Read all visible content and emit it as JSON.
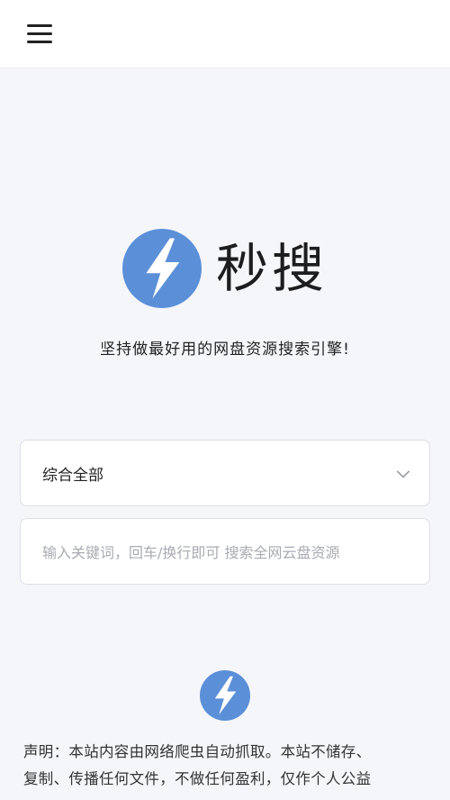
{
  "header": {
    "menu_icon": "hamburger-menu-icon"
  },
  "brand": {
    "logo_icon": "lightning-bolt-icon",
    "name": "秒搜",
    "accent_color": "#5b8fd8",
    "tagline": "坚持做最好用的网盘资源搜索引擎!"
  },
  "search": {
    "category_selected": "综合全部",
    "dropdown_icon": "chevron-down-icon",
    "value": "",
    "placeholder": "输入关键词，回车/换行即可 搜索全网云盘资源"
  },
  "footer": {
    "logo_icon": "lightning-bolt-icon",
    "disclaimer_line1": "声明：本站内容由网络爬虫自动抓取。本站不储存、",
    "disclaimer_line2": "复制、传播任何文件，不做任何盈利，仅作个人公益"
  }
}
